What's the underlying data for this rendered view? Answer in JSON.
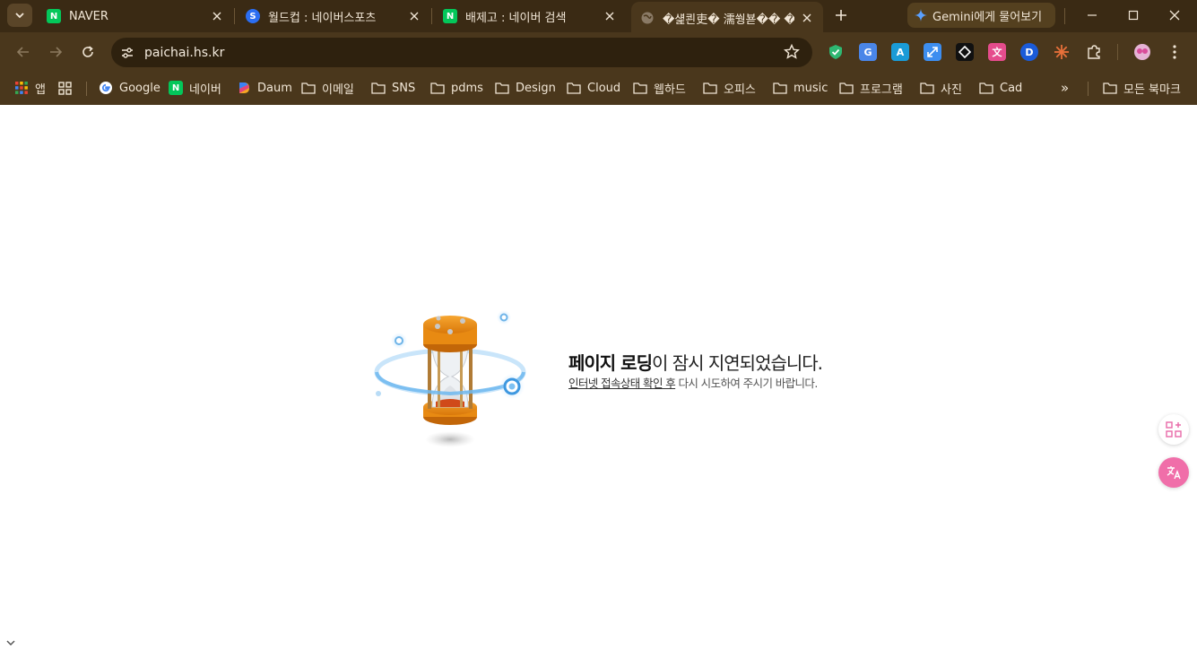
{
  "tabs": [
    {
      "title": "NAVER",
      "favicon": "naver-icon",
      "active": false
    },
    {
      "title": "월드컵 : 네이버스포츠",
      "favicon": "sports-icon",
      "active": false
    },
    {
      "title": "배제고 : 네이버 검색",
      "favicon": "naver-icon",
      "active": false
    },
    {
      "title": "�섍쾬吏� 濡쒕뵫�� �쟾",
      "favicon": "globe-icon",
      "active": true
    }
  ],
  "gemini": {
    "label": "Gemini에게 물어보기"
  },
  "address": {
    "url": "paichai.hs.kr"
  },
  "bookmarks": {
    "apps": "앱",
    "items": [
      {
        "label": "Google",
        "icon": "google-icon"
      },
      {
        "label": "네이버",
        "icon": "naver-icon"
      },
      {
        "label": "Daum",
        "icon": "daum-icon"
      },
      {
        "label": "이메일",
        "icon": "folder-icon"
      },
      {
        "label": "SNS",
        "icon": "folder-icon"
      },
      {
        "label": "pdms",
        "icon": "folder-icon"
      },
      {
        "label": "Design",
        "icon": "folder-icon"
      },
      {
        "label": "Cloud",
        "icon": "folder-icon"
      },
      {
        "label": "웹하드",
        "icon": "folder-icon"
      },
      {
        "label": "오피스",
        "icon": "folder-icon"
      },
      {
        "label": "music",
        "icon": "folder-icon"
      },
      {
        "label": "프로그램",
        "icon": "folder-icon"
      },
      {
        "label": "사진",
        "icon": "folder-icon"
      },
      {
        "label": "Cad",
        "icon": "folder-icon"
      }
    ],
    "overflow": "»",
    "all_bookmarks": "모든 북마크"
  },
  "page": {
    "title_bold": "페이지 로딩",
    "title_rest": "이 잠시 지연되었습니다.",
    "sub_link": "인터넷 접속상태 확인 후",
    "sub_rest": " 다시 시도하여 주시기 바랍니다."
  },
  "colors": {
    "frame": "#3a2a14",
    "toolbar": "#4a371c",
    "omnibox": "#2e210e",
    "naver_green": "#03c75a",
    "hourglass_orange": "#e8890c"
  }
}
